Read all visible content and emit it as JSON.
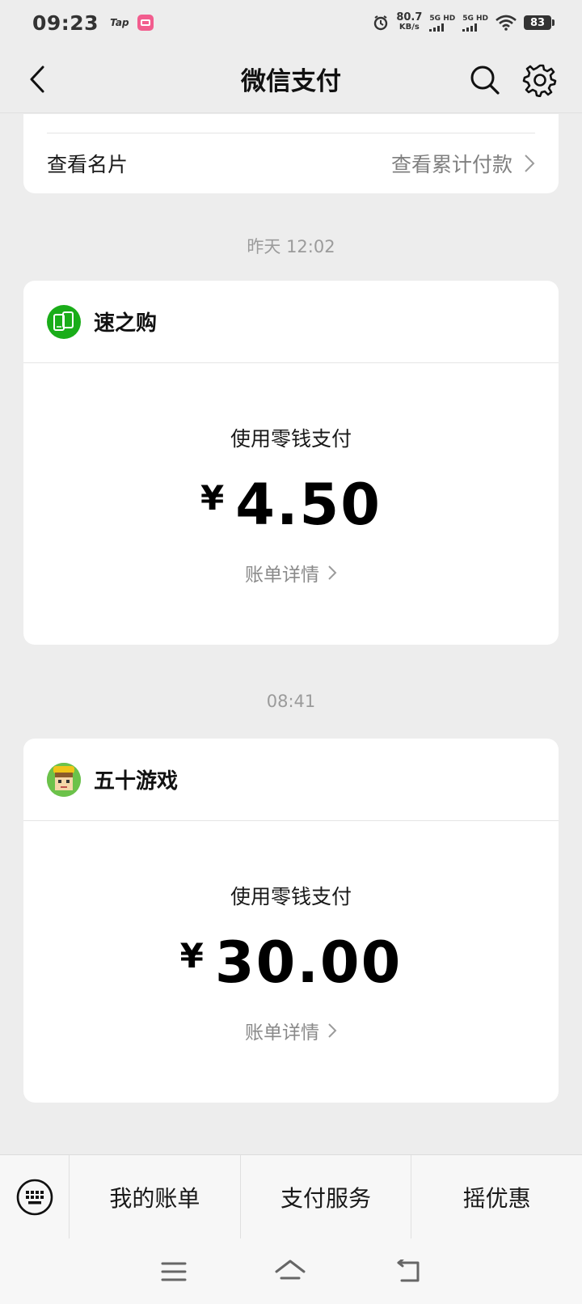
{
  "status": {
    "time": "09:23",
    "app_label": "Tap",
    "speed_value": "80.7",
    "speed_unit": "KB/s",
    "network_1": "5G HD",
    "network_2": "5G HD",
    "battery": "83"
  },
  "nav": {
    "title": "微信支付",
    "back_icon": "chevron-left-icon",
    "search_icon": "search-icon",
    "settings_icon": "gear-icon"
  },
  "top_card": {
    "left_label": "查看名片",
    "right_label": "查看累计付款"
  },
  "transactions": [
    {
      "time": "昨天 12:02",
      "merchant": "速之购",
      "logo_icon": "phones-logo-icon",
      "method": "使用零钱支付",
      "currency": "¥",
      "amount": "4.50",
      "detail_label": "账单详情"
    },
    {
      "time": "08:41",
      "merchant": "五十游戏",
      "logo_icon": "game-character-logo-icon",
      "method": "使用零钱支付",
      "currency": "¥",
      "amount": "30.00",
      "detail_label": "账单详情"
    }
  ],
  "bottom_menu": {
    "keyboard_icon": "keyboard-icon",
    "items": [
      "我的账单",
      "支付服务",
      "摇优惠"
    ]
  },
  "colors": {
    "background": "#ededed",
    "card": "#ffffff",
    "brand_green": "#1aad19",
    "muted_text": "#8a8a8a"
  }
}
